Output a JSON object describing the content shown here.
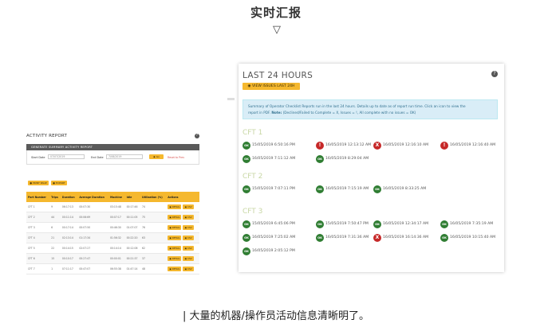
{
  "header": {
    "title": "实时汇报",
    "arrow": "▽"
  },
  "caption": "| 大量的机器/操作员活动信息清晰明了。",
  "activity_report": {
    "title": "ACTIVITY REPORT",
    "help": "?",
    "section_bar": "GENERATE SUMMARY ACTIVITY REPORT",
    "start_label": "Start Date",
    "start_value": "07/07/2019",
    "end_label": "End Date",
    "end_value": "7/08/2019",
    "go_button": "◉ Go",
    "reset_link": "Reset to Prev",
    "print_button": "● PRINT PAGE",
    "export_button": "● EXPORT",
    "columns": [
      "Part Number",
      "Trips",
      "Duration",
      "Average Duration",
      "Machine",
      "Idle",
      "Utilization (%)",
      "Actions"
    ],
    "rows": [
      [
        "CFT 1",
        "9",
        "06:17:13",
        "00:07:30",
        "03:15:48",
        "00:17:46",
        "74"
      ],
      [
        "CFT 2",
        "44",
        "00:11:14",
        "00:06:69",
        "00:07:17",
        "00:11:05",
        "75"
      ],
      [
        "CFT 3",
        "6",
        "00:17:14",
        "00:07:50",
        "00:46:30",
        "01:07:07",
        "76"
      ],
      [
        "CFT 4",
        "21",
        "02:13:14",
        "01:17:34",
        "01:56:32",
        "00:22:20",
        "63"
      ],
      [
        "CFT 5",
        "22",
        "00:14:15",
        "02:07:27",
        "00:14:14",
        "00:12:06",
        "62"
      ],
      [
        "CFT 6",
        "15",
        "00:10:17",
        "00:27:47",
        "00:00:01",
        "00:21:37",
        "37"
      ],
      [
        "CFT 7",
        "1",
        "07:11:17",
        "00:47:07",
        "06:55:38",
        "01:47:14",
        "48"
      ]
    ],
    "row_detail": "▣ DETAIL",
    "row_csv": "▣ CSV"
  },
  "last24": {
    "title": "LAST 24 HOURS",
    "help": "?",
    "view_button": "◉ VIEW ISSUES LAST 24H",
    "info_line1": "Summary of Operator Checklist Reports run in the last 24 hours. Details up to date as of report run time. Click an icon to view the",
    "info_line2_pre": "report in PDF. ",
    "info_note": "Note:",
    "info_line2_post": " (Declined/Failed to Complete = X, Issues = !, All complete with no issues = OK)",
    "sections": [
      {
        "name": "CFT 1",
        "entries": [
          {
            "status": "OK",
            "time": "15/05/2019 6:50:16 PM"
          },
          {
            "status": "!",
            "time": "16/05/2019 12:13:12 AM"
          },
          {
            "status": "X",
            "time": "16/05/2019 12:16:10 AM"
          },
          {
            "status": "!",
            "time": "16/05/2019 12:16:40 AM"
          },
          {
            "status": "OK",
            "time": "16/05/2019 7:11:12 AM"
          },
          {
            "status": "OK",
            "time": "16/05/2019 8:29:04 AM"
          }
        ]
      },
      {
        "name": "CFT 2",
        "entries": [
          {
            "status": "OK",
            "time": "15/05/2019 7:07:11 PM"
          },
          {
            "status": "OK",
            "time": "16/05/2019 7:15:19 AM"
          },
          {
            "status": "OK",
            "time": "16/05/2019 8:33:25 AM"
          }
        ]
      },
      {
        "name": "CFT 3",
        "entries": [
          {
            "status": "OK",
            "time": "15/05/2019 6:45:06 PM"
          },
          {
            "status": "OK",
            "time": "15/05/2019 7:50:47 PM"
          },
          {
            "status": "OK",
            "time": "16/05/2019 12:34:17 AM"
          },
          {
            "status": "OK",
            "time": "16/05/2019 7:35:19 AM"
          },
          {
            "status": "OK",
            "time": "16/05/2019 7:25:02 AM"
          },
          {
            "status": "OK",
            "time": "16/05/2019 7:31:36 AM"
          },
          {
            "status": "X",
            "time": "16/05/2019 16:14:36 AM"
          },
          {
            "status": "OK",
            "time": "16/05/2019 10:15:40 AM"
          },
          {
            "status": "OK",
            "time": "16/05/2019 2:05:12 PM"
          }
        ]
      }
    ]
  },
  "colors": {
    "accent": "#f5b82e",
    "ok": "#2f7d32",
    "issue": "#c62828",
    "info_bg": "#d9edf7"
  }
}
